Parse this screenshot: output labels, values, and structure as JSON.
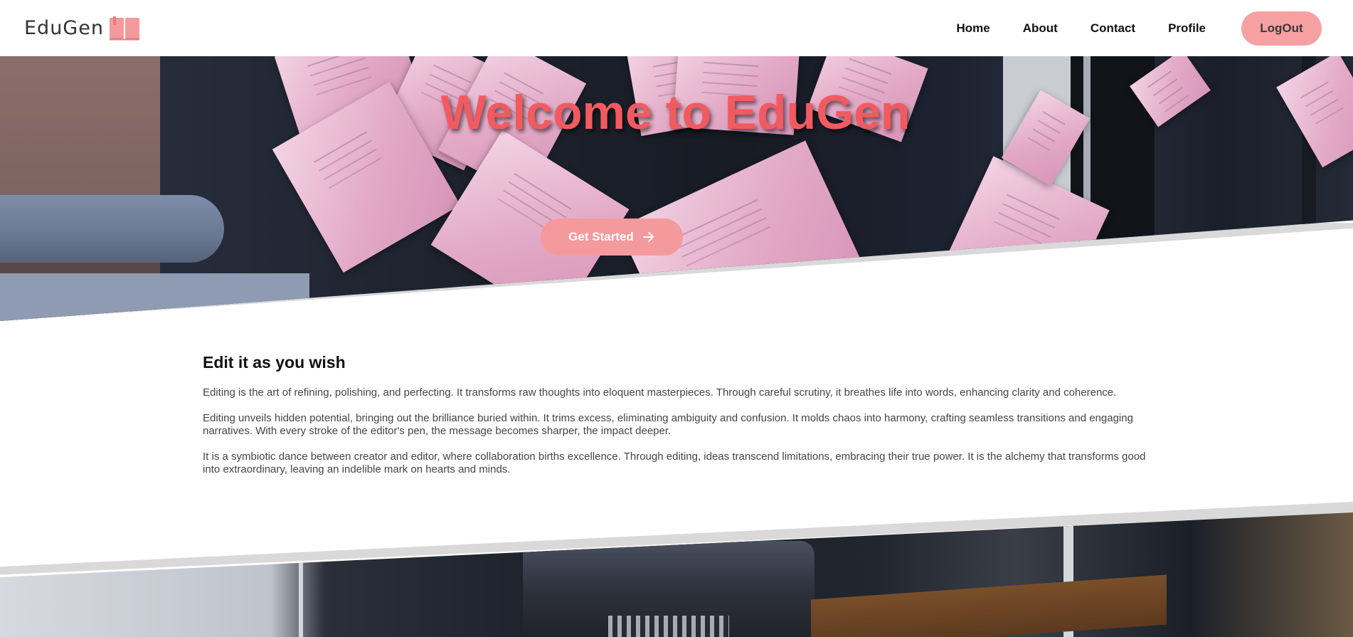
{
  "brand": {
    "name": "EduGen"
  },
  "nav": {
    "links": [
      "Home",
      "About",
      "Contact",
      "Profile"
    ],
    "logout_label": "LogOut"
  },
  "hero": {
    "title": "Welcome to EduGen",
    "cta_label": "Get Started"
  },
  "section": {
    "heading": "Edit it as you wish",
    "paragraphs": [
      "Editing is the art of refining, polishing, and perfecting. It transforms raw thoughts into eloquent masterpieces. Through careful scrutiny, it breathes life into words, enhancing clarity and coherence.",
      "Editing unveils hidden potential, bringing out the brilliance buried within. It trims excess, eliminating ambiguity and confusion. It molds chaos into harmony, crafting seamless transitions and engaging narratives. With every stroke of the editor's pen, the message becomes sharper, the impact deeper.",
      "It is a symbiotic dance between creator and editor, where collaboration births excellence. Through editing, ideas transcend limitations, embracing their true power. It is the alchemy that transforms good into extraordinary, leaving an indelible mark on hearts and minds."
    ]
  },
  "colors": {
    "accent": "#f59a9c",
    "title": "#f25a5f",
    "logo_book": "#f29a9c"
  },
  "icons": {
    "logo": "book-icon",
    "cta": "arrow-right-icon"
  }
}
